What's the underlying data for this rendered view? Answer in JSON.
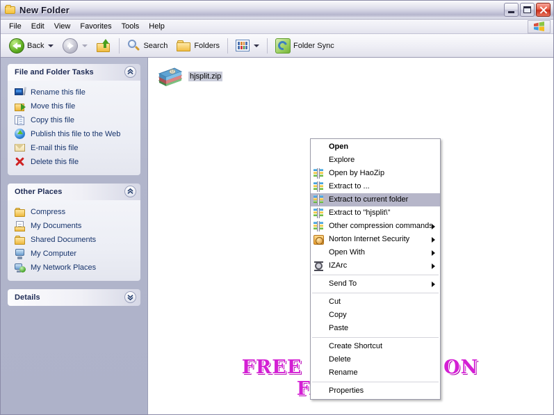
{
  "window": {
    "title": "New Folder",
    "icon": "folder-icon",
    "buttons": {
      "minimize": "minimize-button",
      "maximize": "maximize-button",
      "close": "close-button"
    }
  },
  "menubar": {
    "items": [
      "File",
      "Edit",
      "View",
      "Favorites",
      "Tools",
      "Help"
    ],
    "right_logo": "windows-flag-icon"
  },
  "toolbar": {
    "back_label": "Back",
    "forward_label": "",
    "up_label": "",
    "search_label": "Search",
    "folders_label": "Folders",
    "views_label": "",
    "folder_sync_label": "Folder Sync"
  },
  "sidebar": {
    "panels": [
      {
        "title": "File and Folder Tasks",
        "collapse_icon": "chevron-up-icon",
        "items": [
          {
            "label": "Rename this file",
            "icon": "rename-icon"
          },
          {
            "label": "Move this file",
            "icon": "move-icon"
          },
          {
            "label": "Copy this file",
            "icon": "copy-icon"
          },
          {
            "label": "Publish this file to the Web",
            "icon": "publish-web-icon"
          },
          {
            "label": "E-mail this file",
            "icon": "email-icon"
          },
          {
            "label": "Delete this file",
            "icon": "delete-icon"
          }
        ]
      },
      {
        "title": "Other Places",
        "collapse_icon": "chevron-up-icon",
        "items": [
          {
            "label": "Compress",
            "icon": "folder-icon"
          },
          {
            "label": "My Documents",
            "icon": "my-documents-icon"
          },
          {
            "label": "Shared Documents",
            "icon": "folder-icon"
          },
          {
            "label": "My Computer",
            "icon": "my-computer-icon"
          },
          {
            "label": "My Network Places",
            "icon": "network-places-icon"
          }
        ]
      },
      {
        "title": "Details",
        "collapse_icon": "chevron-down-icon",
        "items": []
      }
    ]
  },
  "content": {
    "file": {
      "name": "hjsplit.zip",
      "icon": "zip-archive-icon",
      "selected": true
    },
    "watermark": "FREE SOFTWARE ON FACEBOOK"
  },
  "context_menu": {
    "groups": [
      [
        {
          "label": "Open",
          "bold": true,
          "icon": null,
          "submenu": false,
          "selected": false
        },
        {
          "label": "Explore",
          "bold": false,
          "icon": null,
          "submenu": false,
          "selected": false
        },
        {
          "label": "Open by HaoZip",
          "bold": false,
          "icon": "haozip-icon",
          "submenu": false,
          "selected": false
        },
        {
          "label": "Extract to ...",
          "bold": false,
          "icon": "haozip-icon",
          "submenu": false,
          "selected": false
        },
        {
          "label": "Extract to current folder",
          "bold": false,
          "icon": "haozip-icon",
          "submenu": false,
          "selected": true
        },
        {
          "label": "Extract to \"hjsplit\\\"",
          "bold": false,
          "icon": "haozip-icon",
          "submenu": false,
          "selected": false
        },
        {
          "label": "Other compression commands",
          "bold": false,
          "icon": "haozip-icon",
          "submenu": true,
          "selected": false
        },
        {
          "label": "Norton Internet Security",
          "bold": false,
          "icon": "norton-icon",
          "submenu": true,
          "selected": false
        },
        {
          "label": "Open With",
          "bold": false,
          "icon": null,
          "submenu": true,
          "selected": false
        },
        {
          "label": "IZArc",
          "bold": false,
          "icon": "izarc-icon",
          "submenu": true,
          "selected": false
        }
      ],
      [
        {
          "label": "Send To",
          "bold": false,
          "icon": null,
          "submenu": true,
          "selected": false
        }
      ],
      [
        {
          "label": "Cut",
          "bold": false,
          "icon": null,
          "submenu": false,
          "selected": false
        },
        {
          "label": "Copy",
          "bold": false,
          "icon": null,
          "submenu": false,
          "selected": false
        },
        {
          "label": "Paste",
          "bold": false,
          "icon": null,
          "submenu": false,
          "selected": false
        }
      ],
      [
        {
          "label": "Create Shortcut",
          "bold": false,
          "icon": null,
          "submenu": false,
          "selected": false
        },
        {
          "label": "Delete",
          "bold": false,
          "icon": null,
          "submenu": false,
          "selected": false
        },
        {
          "label": "Rename",
          "bold": false,
          "icon": null,
          "submenu": false,
          "selected": false
        }
      ],
      [
        {
          "label": "Properties",
          "bold": false,
          "icon": null,
          "submenu": false,
          "selected": false
        }
      ]
    ]
  },
  "colors": {
    "titlebar_dark": "#b6b6cd",
    "sidebar_bg": "#b1b5cb",
    "panel_body": "#eceef5",
    "link_text": "#16336b",
    "menu_highlight": "#b6b6c9",
    "watermark": "#d41fd4",
    "close_button": "#c92e1b"
  }
}
